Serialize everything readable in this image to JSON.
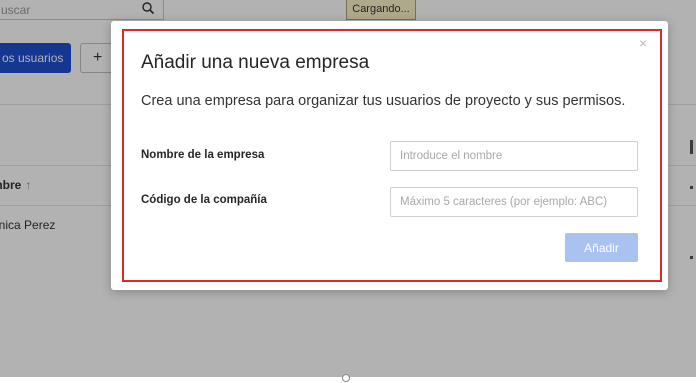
{
  "background": {
    "search": {
      "placeholder": "uscar"
    },
    "loading_label": "Cargando...",
    "add_users_label": "os usuarios",
    "plus_label": "+",
    "table": {
      "column_header": "mbre",
      "sort_arrow": "↑",
      "rows": [
        {
          "name": "onica Perez"
        }
      ]
    }
  },
  "modal": {
    "title": "Añadir una nueva empresa",
    "description": "Crea una empresa para organizar tus usuarios de proyecto y sus permisos.",
    "close_icon": "×",
    "fields": {
      "company_name": {
        "label": "Nombre de la empresa",
        "value": "",
        "placeholder": "Introduce el nombre"
      },
      "company_code": {
        "label": "Código de la compañía",
        "value": "",
        "placeholder": "Máximo 5 caracteres (por ejemplo: ABC)"
      }
    },
    "add_button_label": "Añadir"
  },
  "colors": {
    "primary": "#1f4fd0",
    "add_button_disabled": "#a9c2f2",
    "highlight_border": "#e0272b",
    "loading_bg": "#fbf3c8"
  }
}
